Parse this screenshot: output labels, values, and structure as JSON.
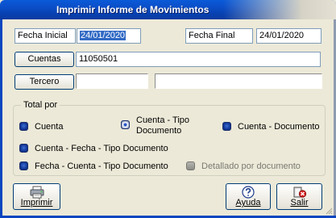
{
  "window": {
    "title": "Imprimir Informe de Movimientos"
  },
  "dates": {
    "start_label": "Fecha Inicial",
    "start_value": "24/01/2020",
    "end_label": "Fecha Final",
    "end_value": "24/01/2020"
  },
  "cuentas": {
    "button_label": "Cuentas",
    "value": "11050501"
  },
  "tercero": {
    "button_label": "Tercero",
    "code_value": "",
    "name_value": ""
  },
  "total_por": {
    "group_title": "Total por",
    "options": [
      {
        "label": "Cuenta",
        "state": "on"
      },
      {
        "label": "Cuenta - Tipo",
        "label2": "Documento",
        "state": "selected"
      },
      {
        "label": "Cuenta - Documento",
        "state": "on"
      },
      {
        "label": "Cuenta - Fecha - Tipo Documento",
        "state": "on"
      },
      {
        "label": "Fecha - Cuenta - Tipo Documento",
        "state": "on"
      },
      {
        "label": "Detallado por documento",
        "state": "disabled"
      }
    ]
  },
  "actions": {
    "print_label": "Imprimir",
    "help_label": "Ayuda",
    "exit_label": "Salir"
  },
  "icons": {
    "print": "printer-icon",
    "help": "help-icon",
    "exit": "exit-icon"
  }
}
